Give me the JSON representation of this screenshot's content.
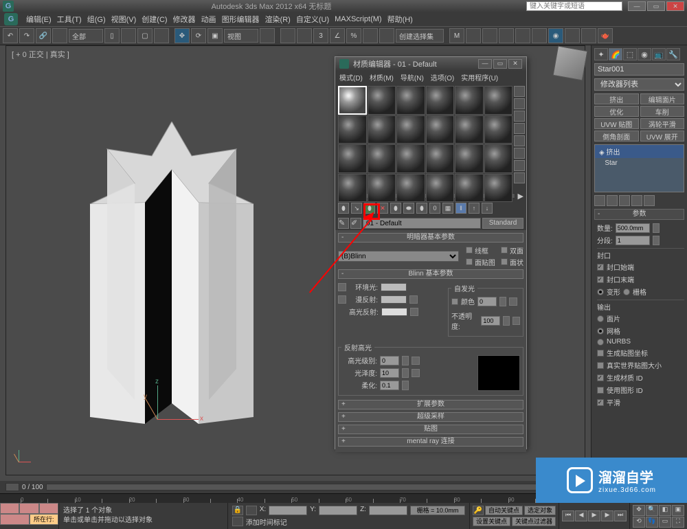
{
  "title_bar": {
    "app_title": "Autodesk 3ds Max 2012 x64   无标题",
    "search_placeholder": "键入关键字或短语"
  },
  "menu": {
    "items": [
      "编辑(E)",
      "工具(T)",
      "组(G)",
      "视图(V)",
      "创建(C)",
      "修改器",
      "动画",
      "图形编辑器",
      "渲染(R)",
      "自定义(U)",
      "MAXScript(M)",
      "帮助(H)"
    ]
  },
  "toolbar": {
    "selection_mode": "全部",
    "view_label": "视图",
    "selection_set": "创建选择集"
  },
  "viewport": {
    "label": "[ + 0 正交 | 真实 ]"
  },
  "cmd_panel": {
    "object_name": "Star001",
    "mod_dropdown": "修改器列表",
    "buttons": [
      "挤出",
      "编辑面片",
      "优化",
      "车削",
      "UVW 贴图",
      "涡轮平滑",
      "倒角剖面",
      "UVW 展开"
    ],
    "stack": [
      "挤出",
      "Star"
    ],
    "rollout1_title": "参数",
    "amount_label": "数量:",
    "amount_value": "500.0mm",
    "segments_label": "分段:",
    "segments_value": "1",
    "capping_label": "封口",
    "cap_start": "封口始端",
    "cap_end": "封口末端",
    "morph": "变形",
    "grid": "栅格",
    "output_label": "输出",
    "output_patch": "面片",
    "output_mesh": "网格",
    "output_nurbs": "NURBS",
    "gen_map": "生成贴图坐标",
    "real_world": "真实世界贴图大小",
    "gen_mat_id": "生成材质 ID",
    "use_shape_id": "使用图形 ID",
    "smooth": "平滑"
  },
  "mat_editor": {
    "title": "材质编辑器 - 01 - Default",
    "menu": [
      "模式(D)",
      "材质(M)",
      "导航(N)",
      "选项(O)",
      "实用程序(U)"
    ],
    "mat_name": "01 - Default",
    "mat_type": "Standard",
    "rollout_shader": "明暗器基本参数",
    "shader_type": "(B)Blinn",
    "wire": "线框",
    "two_sided": "双面",
    "face_map": "面贴图",
    "faceted": "面状",
    "rollout_blinn": "Blinn 基本参数",
    "ambient": "环境光:",
    "diffuse": "漫反射:",
    "specular": "高光反射:",
    "self_illum_group": "自发光",
    "color_chk": "颜色",
    "color_val": "0",
    "opacity": "不透明度:",
    "opacity_val": "100",
    "spec_group": "反射高光",
    "spec_level": "高光级别:",
    "spec_level_val": "0",
    "glossiness": "光泽度:",
    "glossiness_val": "10",
    "soften": "柔化:",
    "soften_val": "0.1",
    "rollout_ext": "扩展参数",
    "rollout_ss": "超级采样",
    "rollout_maps": "贴图",
    "rollout_mr": "mental ray 连接"
  },
  "status": {
    "tab_active": "所在行:",
    "line1": "选择了 1 个对象",
    "line2": "单击或单击并拖动以选择对象",
    "add_time_tag": "添加时间标记",
    "x": "X:",
    "y": "Y:",
    "z": "Z:",
    "grid": "栅格 = 10.0mm",
    "auto_key": "自动关键点",
    "sel_filter": "选定对象",
    "set_key": "设置关键点",
    "key_filter": "关键点过滤器"
  },
  "time": {
    "range": "0 / 100"
  },
  "watermark": {
    "big": "溜溜自学",
    "small": "zixue.3d66.com"
  }
}
